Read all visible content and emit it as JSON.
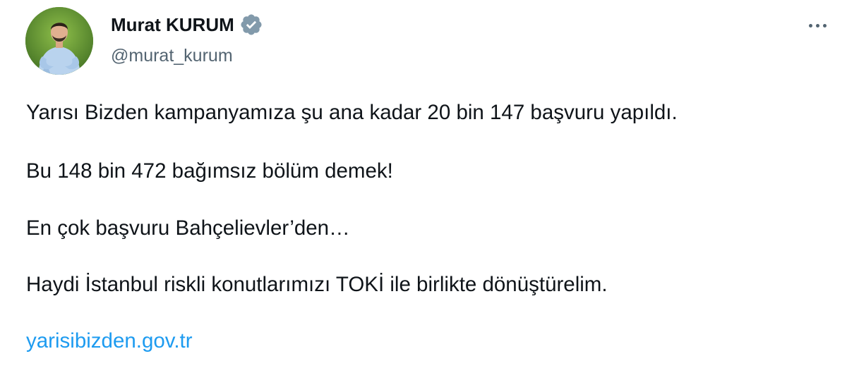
{
  "author": {
    "display_name": "Murat KURUM",
    "handle": "@murat_kurum",
    "verified_color": "#829aab"
  },
  "tweet": {
    "paragraphs": [
      "Yarısı Bizden kampanyamıza şu ana kadar 20 bin 147 başvuru yapıldı.",
      "Bu 148 bin 472 bağımsız bölüm demek!",
      "En çok başvuru Bahçelievler’den…",
      "Haydi İstanbul riskli konutlarımızı TOKİ ile birlikte dönüştürelim."
    ],
    "link_text": "yarisibizden.gov.tr"
  },
  "icons": {
    "more": "more-horizontal-icon",
    "verified": "verified-badge-icon",
    "avatar": "profile-photo"
  },
  "colors": {
    "text": "#0f1419",
    "secondary": "#536471",
    "link": "#1d9bf0"
  }
}
